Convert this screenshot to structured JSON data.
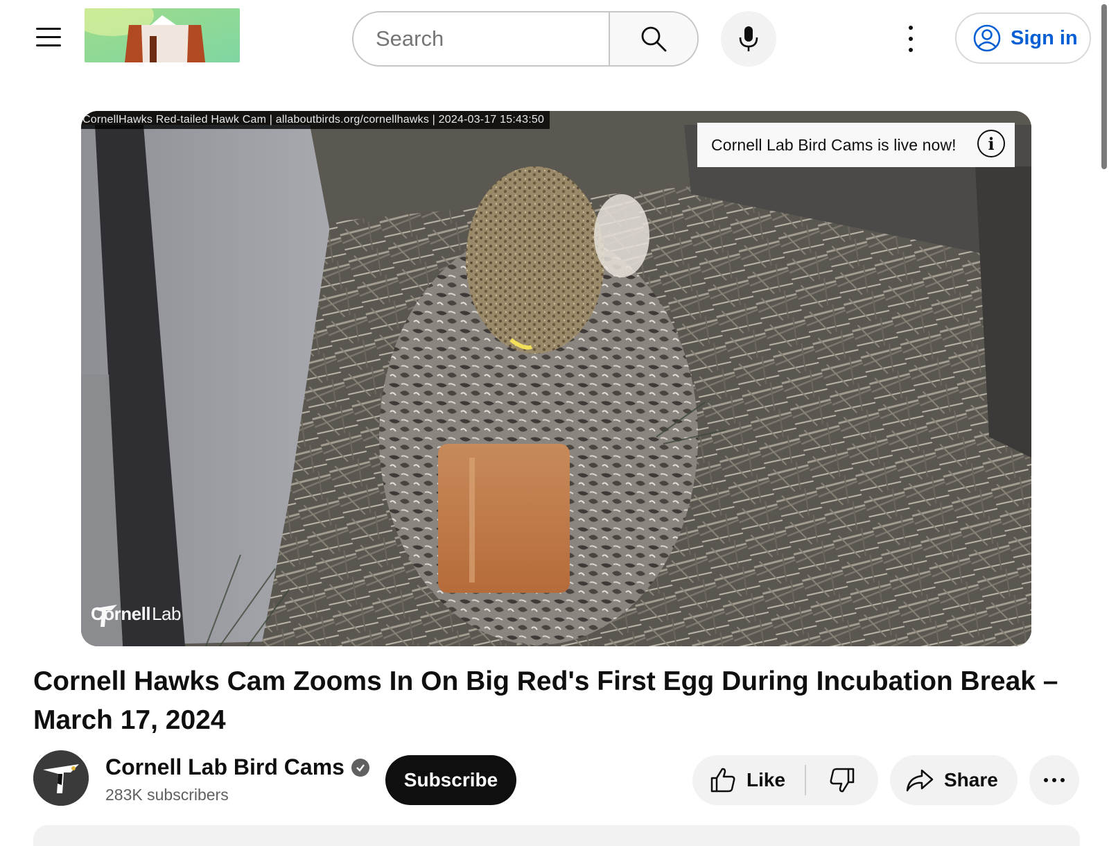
{
  "header": {
    "search": {
      "placeholder": "Search",
      "value": ""
    },
    "sign_in_label": "Sign in"
  },
  "player": {
    "camera_overlay": "CornellHawks Red-tailed Hawk Cam | allaboutbirds.org/cornellhawks | 2024-03-17 15:43:50",
    "live_banner": "Cornell Lab Bird Cams is live now!",
    "watermark": {
      "brand": "Cornell",
      "suffix": "Lab"
    }
  },
  "video": {
    "title": "Cornell Hawks Cam Zooms In On Big Red's First Egg During Incubation Break – March 17, 2024"
  },
  "channel": {
    "name": "Cornell Lab Bird Cams",
    "subscribers": "283K subscribers",
    "subscribe_label": "Subscribe"
  },
  "actions": {
    "like_label": "Like",
    "share_label": "Share"
  },
  "icons": {
    "menu": "hamburger-menu-icon",
    "search": "search-icon",
    "mic": "microphone-icon",
    "more": "more-vertical-icon",
    "account": "account-circle-icon",
    "info": "info-icon",
    "verified": "verified-check-icon",
    "like": "thumbs-up-icon",
    "dislike": "thumbs-down-icon",
    "share": "share-arrow-icon",
    "more_actions": "more-horizontal-icon"
  },
  "colors": {
    "link_blue": "#065fd4",
    "button_black": "#0f0f0f",
    "chip_gray": "#f2f2f2",
    "secondary_text": "#606060"
  }
}
